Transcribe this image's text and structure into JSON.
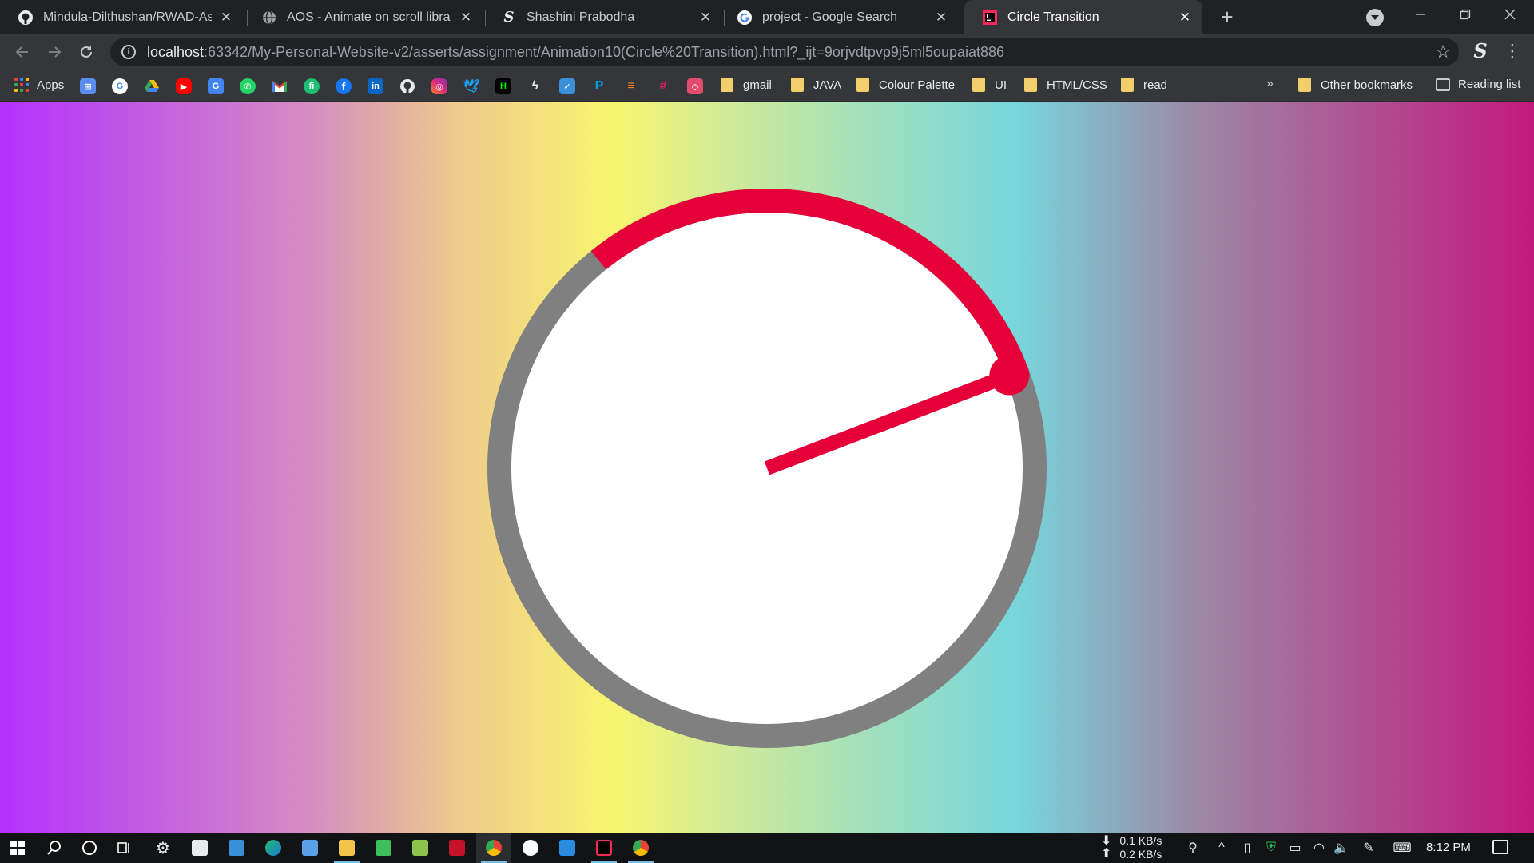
{
  "browser": {
    "tabs": [
      {
        "title": "Mindula-Dilthushan/RWAD-Assig",
        "favicon": "github-icon",
        "active": false
      },
      {
        "title": "AOS - Animate on scroll library",
        "favicon": "globe-icon",
        "active": false
      },
      {
        "title": "Shashini Prabodha",
        "favicon": "script-s-icon",
        "active": false
      },
      {
        "title": "project - Google Search",
        "favicon": "google-icon",
        "active": false
      },
      {
        "title": "Circle Transition",
        "favicon": "intellij-icon",
        "active": true
      }
    ],
    "new_tab_label": "+",
    "close_glyph": "✕"
  },
  "address_bar": {
    "host": "localhost",
    "path": ":63342/My-Personal-Website-v2/asserts/assignment/Animation10(Circle%20Transition).html?_ijt=9orjvdtpvp9j5ml5oupaiat886"
  },
  "bookmarks": {
    "apps_label": "Apps",
    "icons": [
      "microsoft-store-icon",
      "google-icon",
      "drive-icon",
      "youtube-icon",
      "translate-icon",
      "whatsapp-icon",
      "gmail-icon",
      "fiverr-icon",
      "facebook-icon",
      "linkedin-icon",
      "github-icon",
      "instagram-icon",
      "twitter-icon",
      "hackernoon-icon",
      "stackblitz-icon",
      "flutter-icon",
      "paypal-icon",
      "stackoverflow-icon",
      "slack-icon",
      "codepen-icon"
    ],
    "folders": [
      "gmail",
      "JAVA",
      "Colour Palette",
      "UI",
      "HTML/CSS",
      "read"
    ],
    "more_glyph": "»",
    "other_label": "Other bookmarks",
    "reading_label": "Reading list"
  },
  "page": {
    "progress": 0.3,
    "background_colors": [
      "#b431ff",
      "#d48cc2",
      "#eecb8b",
      "#f9f56f",
      "#cde99a",
      "#a5e0ba",
      "#77d7dc",
      "#9c88a6",
      "#c2197c"
    ],
    "ring_track_color": "#808080",
    "ring_progress_color": "#e5003a",
    "face_color": "#ffffff"
  },
  "taskbar": {
    "net_down": "0.1 KB/s",
    "net_up": "0.2 KB/s",
    "time": "8:12 PM"
  }
}
